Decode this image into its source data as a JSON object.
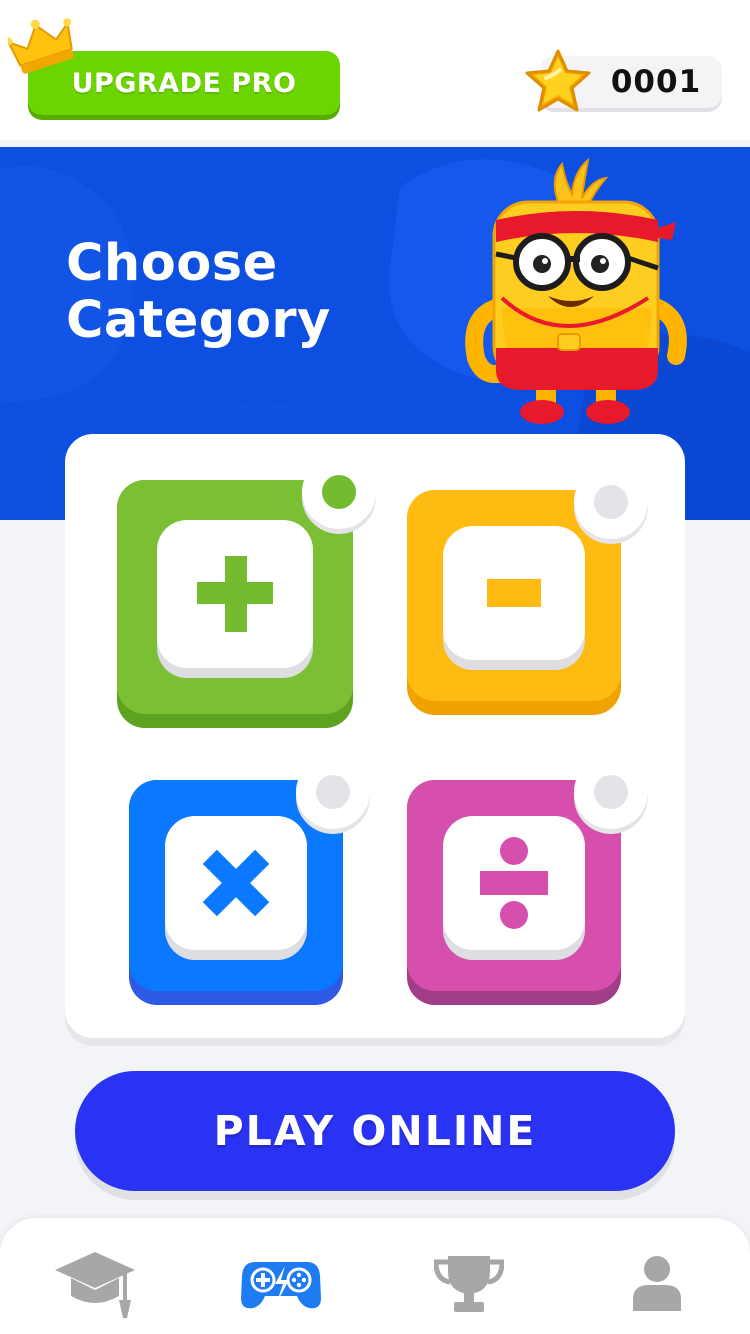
{
  "header": {
    "upgrade_label": "UPGRADE PRO",
    "crown_icon": "crown-icon",
    "star_icon": "star-icon",
    "score": "0001"
  },
  "hero": {
    "title_line1": "Choose",
    "title_line2": "Category",
    "mascot_icon": "mascot-character-icon"
  },
  "categories": [
    {
      "name": "addition",
      "icon": "plus-icon",
      "color": "#7abf34",
      "selected": true
    },
    {
      "name": "subtraction",
      "icon": "minus-icon",
      "color": "#ffbb12",
      "selected": false
    },
    {
      "name": "multiplication",
      "icon": "multiply-icon",
      "color": "#0a78ff",
      "selected": false
    },
    {
      "name": "division",
      "icon": "divide-icon",
      "color": "#d64fac",
      "selected": false
    }
  ],
  "play_button": {
    "label": "PLAY ONLINE"
  },
  "bottom_nav": [
    {
      "icon": "graduation-cap-icon",
      "active": false
    },
    {
      "icon": "gamepad-icon",
      "active": true
    },
    {
      "icon": "trophy-icon",
      "active": false
    },
    {
      "icon": "profile-icon",
      "active": false
    }
  ],
  "colors": {
    "upgrade_green": "#6cd400",
    "hero_blue": "#0d4fe0",
    "play_blue": "#2a32f3",
    "nav_active": "#1e7cf2",
    "nav_inactive": "#a7a7a9"
  }
}
